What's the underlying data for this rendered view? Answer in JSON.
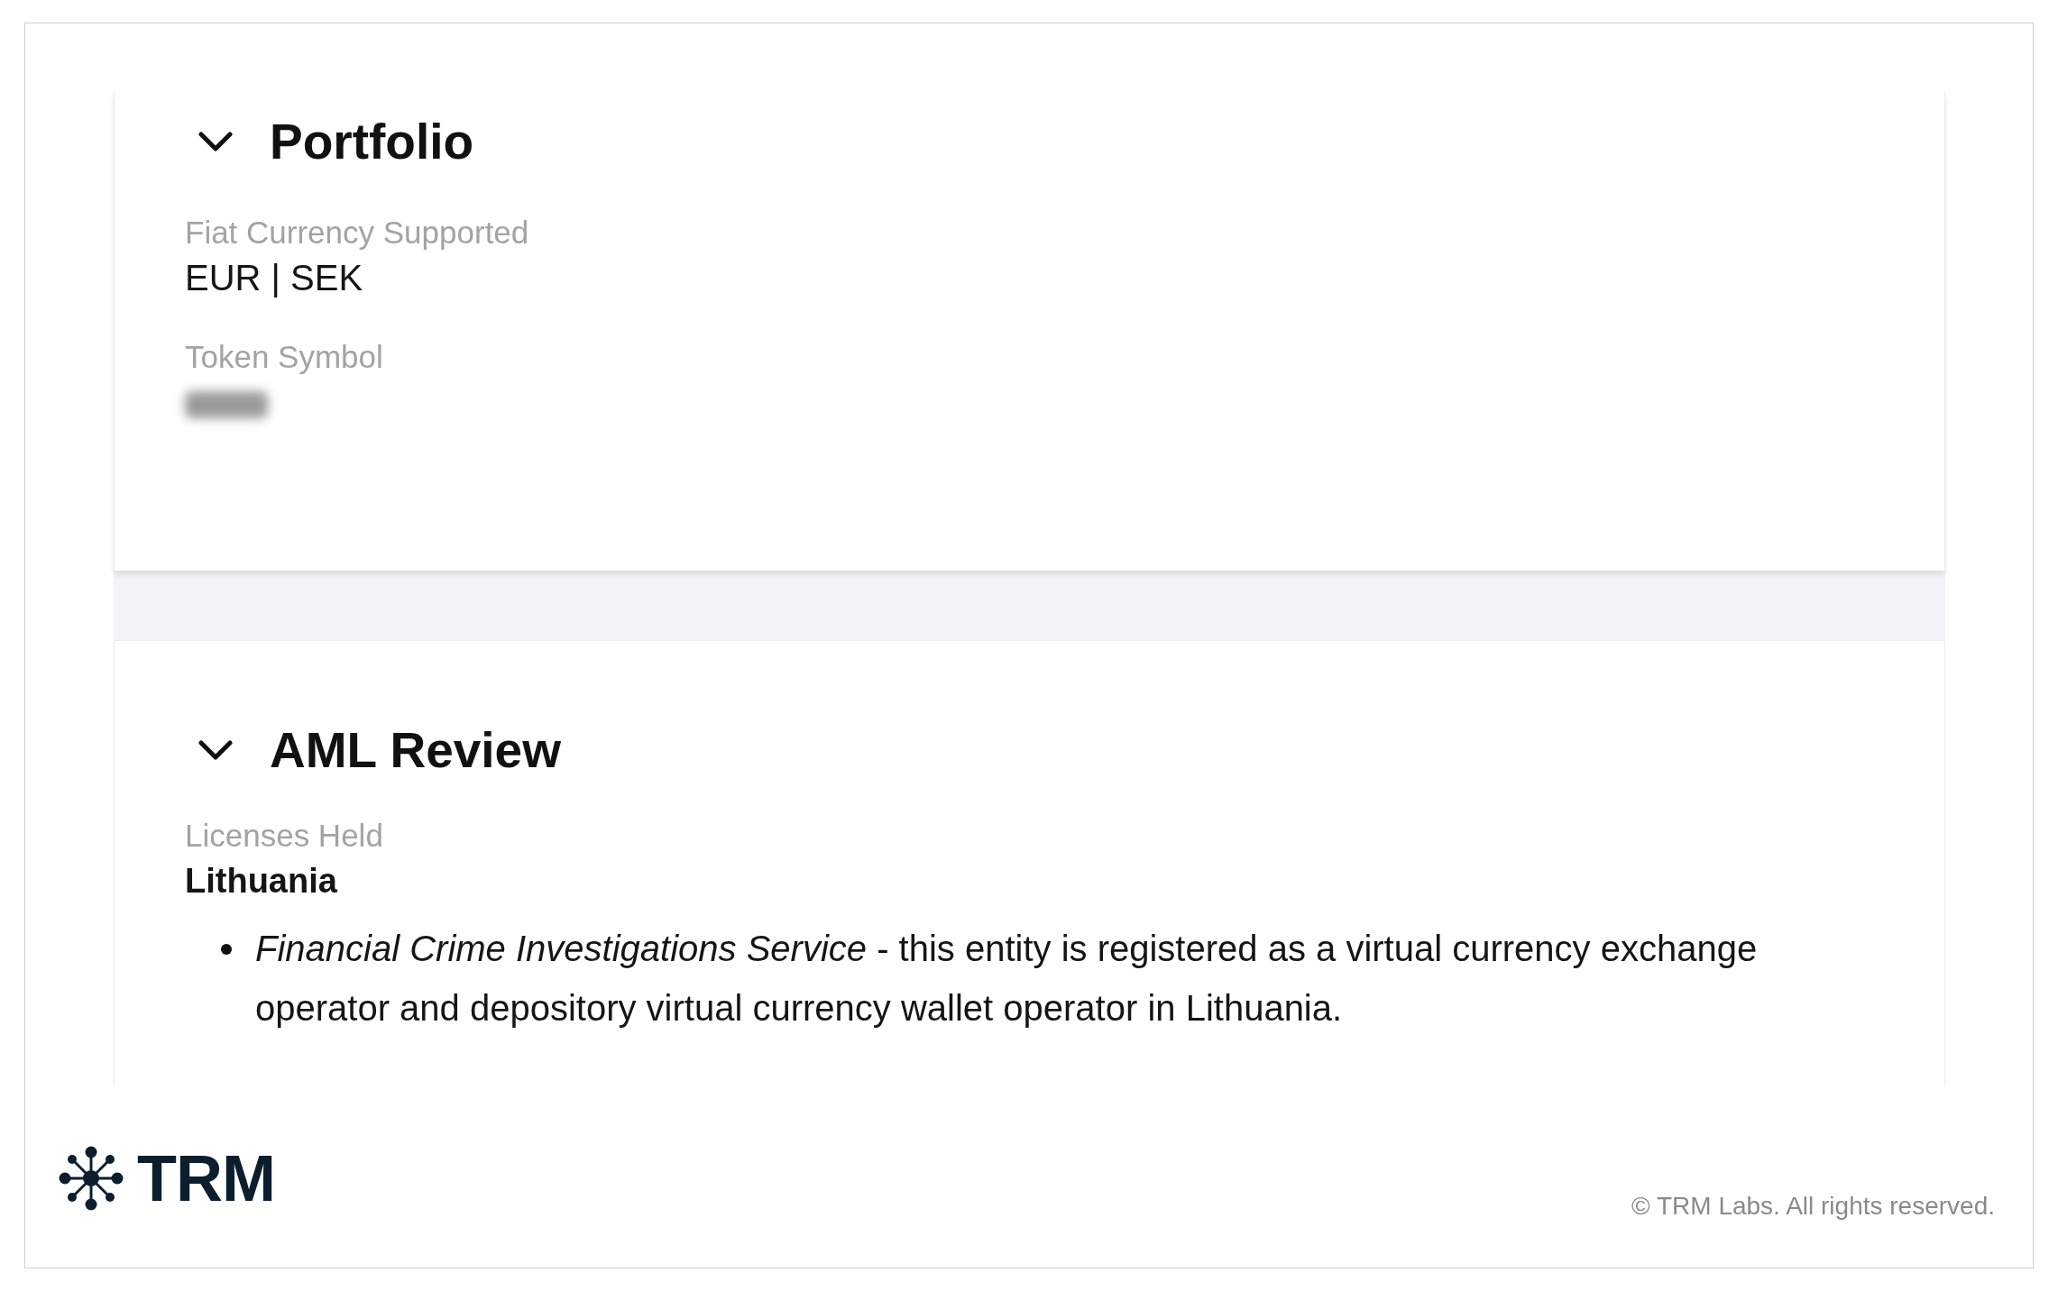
{
  "sections": [
    {
      "title": "Portfolio",
      "expanded": true,
      "fields": [
        {
          "label": "Fiat Currency Supported",
          "kind": "text",
          "value": "EUR | SEK"
        },
        {
          "label": "Token Symbol",
          "kind": "redacted"
        }
      ]
    },
    {
      "title": "AML Review",
      "expanded": true,
      "fields": [
        {
          "label": "Licenses Held",
          "kind": "heading",
          "value": "Lithuania",
          "bullets": [
            "*Financial Crime Investigations Service* - this entity is registered as a virtual currency exchange operator and depository virtual currency wallet operator in Lithuania."
          ]
        }
      ]
    }
  ],
  "footer": {
    "logo": "TRM",
    "copyright": "© TRM Labs. All rights reserved."
  }
}
